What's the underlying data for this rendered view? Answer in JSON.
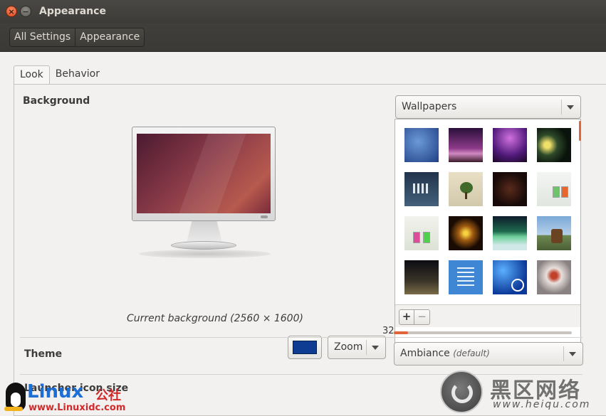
{
  "window": {
    "title": "Appearance",
    "close_glyph": "×",
    "minimize_glyph": "−"
  },
  "breadcrumb": {
    "items": [
      "All Settings",
      "Appearance"
    ]
  },
  "tabs": [
    "Look",
    "Behavior"
  ],
  "background": {
    "label": "Background",
    "caption": "Current background (2560 × 1600)",
    "color_hex": "#0e3c92",
    "mode_select": "Zoom",
    "source_select": "Wallpapers",
    "scroll_position": 0,
    "add_label": "+",
    "remove_label": "−"
  },
  "theme": {
    "label": "Theme",
    "value": "Ambiance",
    "note": "(default)"
  },
  "launcher": {
    "label": "Launcher icon size",
    "value": "32",
    "fraction": 0.0
  },
  "colors": {
    "accent": "#e0653b",
    "titlebar": "#3c3b37",
    "window_bg": "#f2f1f0"
  },
  "watermarks": {
    "left_brand": "Linux",
    "left_cn": "公社",
    "left_url": "www.Linuxidc.com",
    "right_cn": "黑区网络",
    "right_url": "www.heiqu.com"
  }
}
